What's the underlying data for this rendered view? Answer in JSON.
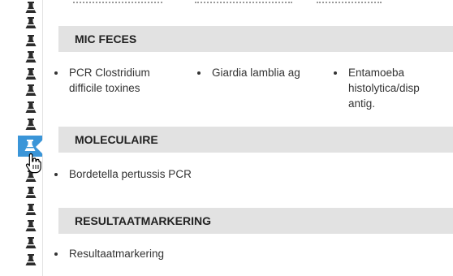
{
  "sections": [
    {
      "title": "MIC FECES",
      "items": [
        {
          "label": "PCR Clostridium difficile toxines"
        },
        {
          "label": "Giardia lamblia ag"
        },
        {
          "label": "Entamoeba histolytica/disp antig."
        }
      ]
    },
    {
      "title": "MOLECULAIRE",
      "items": [
        {
          "label": "Bordetella pertussis PCR"
        }
      ]
    },
    {
      "title": "RESULTAATMARKERING",
      "items": [
        {
          "label": "Resultaatmarkering"
        }
      ]
    }
  ],
  "icons": {
    "rail_icon": "flask-icon",
    "cursor": "hand-pointer-icon"
  },
  "colors": {
    "active": "#3a95d8",
    "header_bg": "#e2e2e2",
    "icon": "#2b2b2b"
  }
}
